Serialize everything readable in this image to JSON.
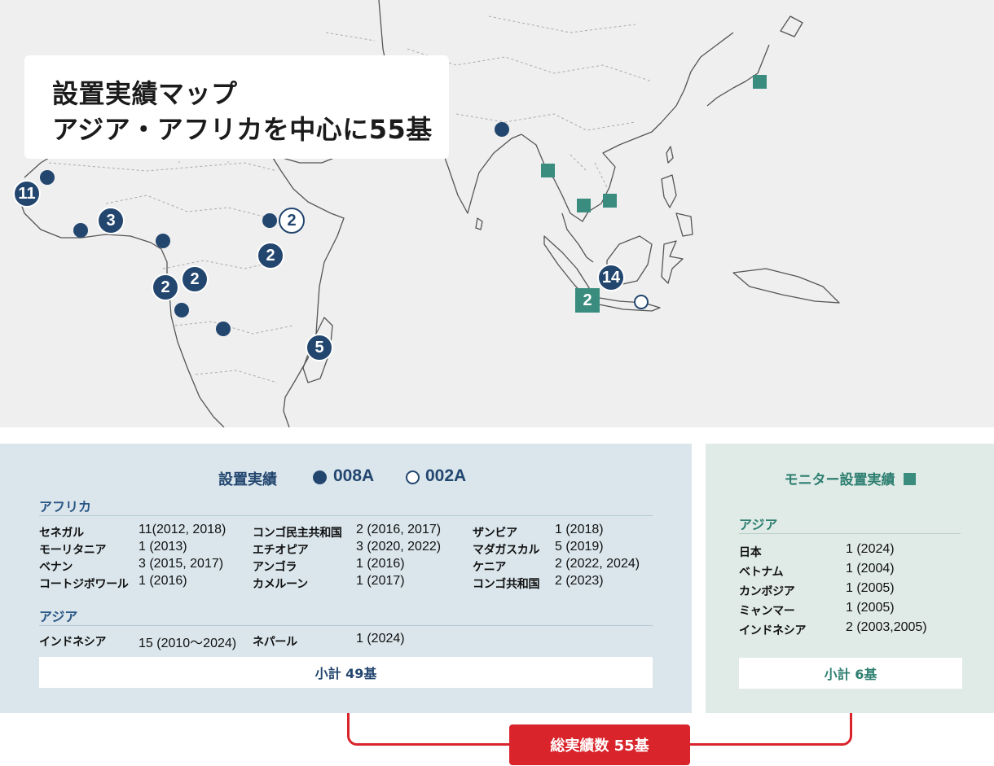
{
  "map": {
    "title_line1": "設置実績マップ",
    "title_line2": "アジア・アフリカを中心に55基",
    "markers": {
      "senegal_count": "11",
      "nigeria_count": "3",
      "ethiopia_count": "2",
      "kenya_count": "2",
      "congo_west_count": "2",
      "congo_east_count": "2",
      "madagascar_count": "5",
      "indonesia_008a_count": "14",
      "indonesia_monitor_count": "2"
    },
    "colors": {
      "model_008a": "#23466f",
      "monitor": "#3a8d7e",
      "land": "#efefef",
      "border": "#555555"
    }
  },
  "left": {
    "legend_title": "設置実績",
    "legend_008a": "008A",
    "legend_002a": "002A",
    "africa_heading": "アフリカ",
    "africa_rows": [
      [
        {
          "c": "セネガル",
          "v": "11(2012, 2018)"
        },
        {
          "c": "コンゴ民主共和国",
          "v": "2 (2016, 2017)"
        },
        {
          "c": "ザンビア",
          "v": "1 (2018)"
        }
      ],
      [
        {
          "c": "モーリタニア",
          "v": "1 (2013)"
        },
        {
          "c": "エチオピア",
          "v": "3 (2020, 2022)"
        },
        {
          "c": "マダガスカル",
          "v": "5 (2019)"
        }
      ],
      [
        {
          "c": "ベナン",
          "v": "3 (2015, 2017)"
        },
        {
          "c": "アンゴラ",
          "v": "1 (2016)"
        },
        {
          "c": "ケニア",
          "v": "2 (2022, 2024)"
        }
      ],
      [
        {
          "c": "コートジボワール",
          "v": "1 (2016)"
        },
        {
          "c": "カメルーン",
          "v": "1 (2017)"
        },
        {
          "c": "コンゴ共和国",
          "v": "2 (2023)"
        }
      ]
    ],
    "asia_heading": "アジア",
    "asia_rows": [
      [
        {
          "c": "インドネシア",
          "v": "15 (2010〜2024)"
        },
        {
          "c": "ネパール",
          "v": "1 (2024)"
        }
      ]
    ],
    "subtotal": "小計 49基"
  },
  "right": {
    "title": "モニター設置実績",
    "asia_heading": "アジア",
    "rows": [
      {
        "c": "日本",
        "v": "1 (2024)"
      },
      {
        "c": "ベトナム",
        "v": "1 (2004)"
      },
      {
        "c": "カンボジア",
        "v": "1 (2005)"
      },
      {
        "c": "ミャンマー",
        "v": "1 (2005)"
      },
      {
        "c": "インドネシア",
        "v": "2 (2003,2005)"
      }
    ],
    "subtotal": "小計 6基"
  },
  "total": "総実績数 55基"
}
